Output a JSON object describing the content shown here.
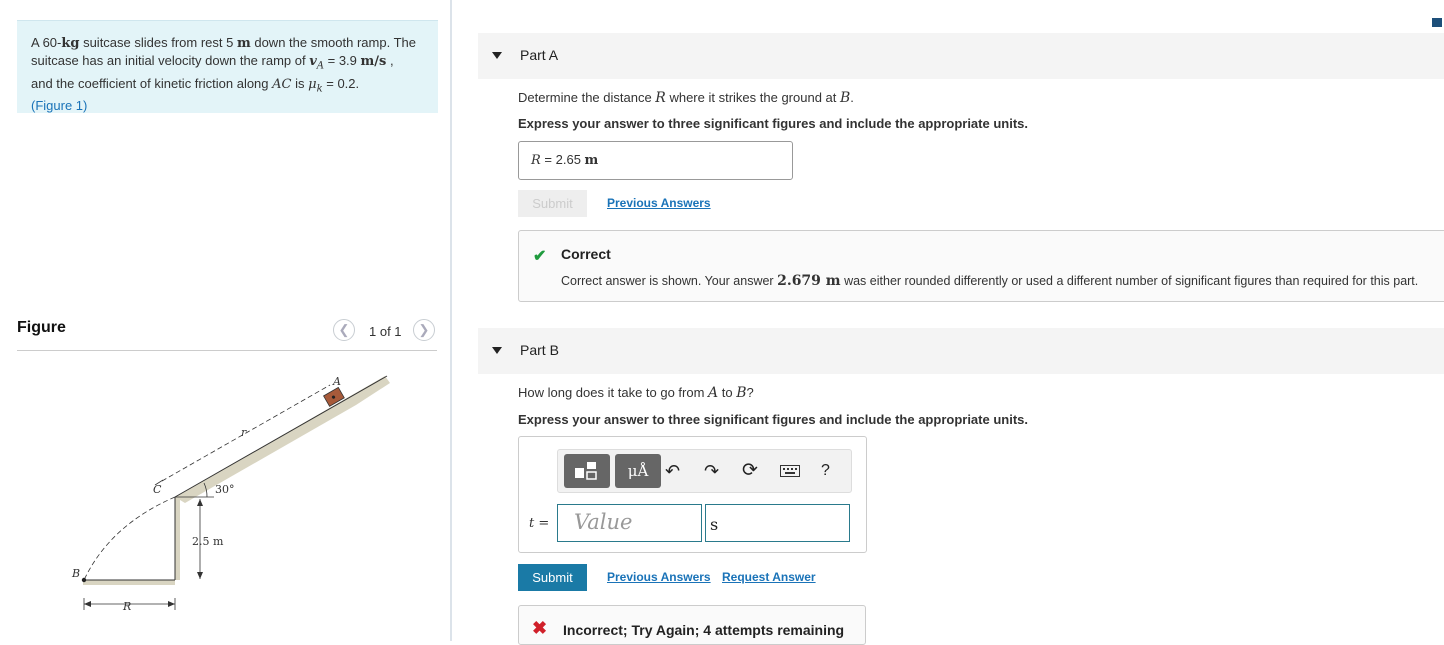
{
  "problem": {
    "line1_pre": "A 60-",
    "line1_unit": "kg",
    "line1_post": " suitcase slides from rest 5 ",
    "line1_unit2": "m",
    "line1_end": " down the smooth ramp. The",
    "line2_pre": "suitcase has an initial velocity down the ramp of ",
    "line2_var": "v",
    "line2_sub": "A",
    "line2_val": " = 3.9 ",
    "line2_unit": "m/s",
    "line2_end": " ,",
    "line3_pre": "and the coefficient of kinetic friction along ",
    "line3_var": "AC",
    "line3_mid": " is ",
    "line3_mu": "μ",
    "line3_sub": "k",
    "line3_val": " = 0.2.",
    "figure_link_open": "(",
    "figure_link": "Figure 1",
    "figure_link_close": ")"
  },
  "figure": {
    "title": "Figure",
    "counter": "1 of 1",
    "prev_icon": "chevron-left-icon",
    "next_icon": "chevron-right-icon",
    "labels": {
      "A": "A",
      "C": "C",
      "B": "B",
      "r": "r",
      "R": "R",
      "angle": "30°",
      "height": "2.5 m"
    }
  },
  "partA": {
    "label": "Part A",
    "question_pre": "Determine the distance ",
    "question_var": "R",
    "question_mid": " where it strikes the ground at ",
    "question_var2": "B",
    "question_end": ".",
    "instruction": "Express your answer to three significant figures and include the appropriate units.",
    "answer_var": "R",
    "answer_eq": " = ",
    "answer_value": "2.65 ",
    "answer_unit": "m",
    "submit_label": "Submit",
    "previous_answers": "Previous Answers",
    "feedback": {
      "title": "Correct",
      "msg_pre": "Correct answer is shown. Your answer ",
      "msg_val": "2.679 m",
      "msg_post": " was either rounded differently or used a different number of significant figures than required for this part."
    }
  },
  "partB": {
    "label": "Part B",
    "question_pre": "How long does it take to go from ",
    "question_var": "A",
    "question_mid": " to ",
    "question_var2": "B",
    "question_end": "?",
    "instruction": "Express your answer to three significant figures and include the appropriate units.",
    "toolbar": {
      "template_icon": "template-icon",
      "units_label": "μÅ",
      "undo_icon": "undo-icon",
      "redo_icon": "redo-icon",
      "reset_icon": "reset-icon",
      "keyboard_icon": "keyboard-icon",
      "help_label": "?"
    },
    "var_label": "t =",
    "value_placeholder": "Value",
    "unit_value": "s",
    "submit_label": "Submit",
    "previous_answers": "Previous Answers",
    "request_answer": "Request Answer",
    "feedback_title": "Incorrect; Try Again; 4 attempts remaining"
  }
}
